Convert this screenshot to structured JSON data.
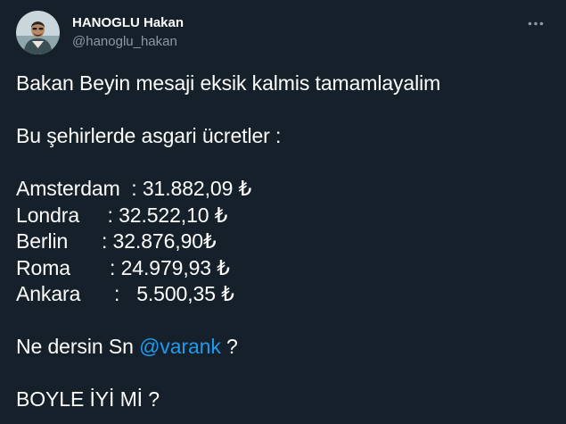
{
  "header": {
    "display_name": "HANOGLU Hakan",
    "handle": "@hanoglu_hakan",
    "avatar_icon": "profile-photo",
    "more_icon": "more-dots-icon"
  },
  "tweet": {
    "line1": "Bakan Beyin mesaji eksik kalmis tamamlayalim",
    "line2": "Bu şehirlerde asgari ücretler :",
    "wages": [
      {
        "city": "Amsterdam",
        "sep": "  : ",
        "amount": "31.882,09 ₺"
      },
      {
        "city": "Londra",
        "sep": "     : ",
        "amount": "32.522,10 ₺"
      },
      {
        "city": "Berlin",
        "sep": "      : ",
        "amount": "32.876,90₺"
      },
      {
        "city": "Roma",
        "sep": "       : ",
        "amount": "24.979,93 ₺"
      },
      {
        "city": "Ankara",
        "sep": "      :   ",
        "amount": "5.500,35 ₺"
      }
    ],
    "question_prefix": "Ne dersin Sn ",
    "mention": "@varank",
    "question_suffix": " ?",
    "closing": "BOYLE İYİ Mİ ?"
  },
  "colors": {
    "background": "#15202b",
    "text": "#ffffff",
    "muted": "#8b98a5",
    "link": "#1d9bf0"
  }
}
